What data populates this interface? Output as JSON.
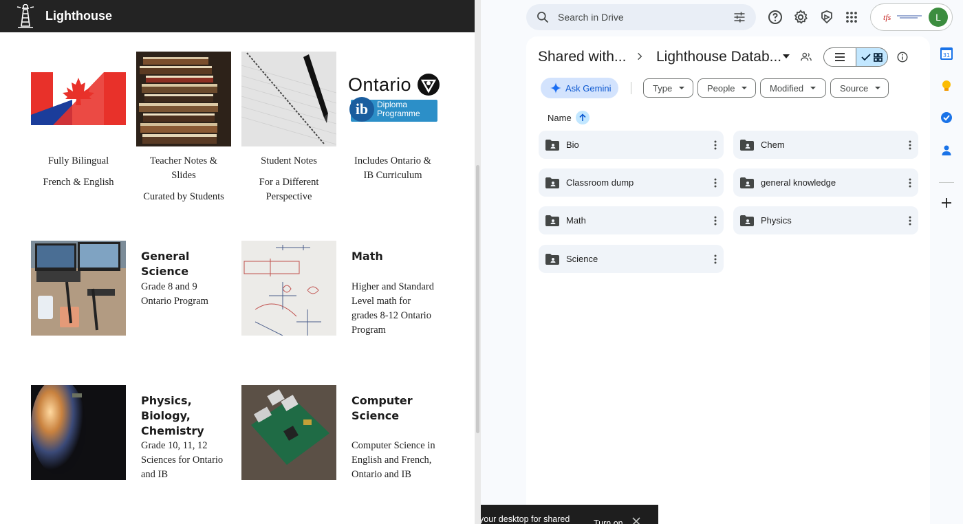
{
  "lighthouse": {
    "brand": "Lighthouse",
    "tiles": [
      {
        "lines": [
          "Fully Bilingual",
          "French & English"
        ]
      },
      {
        "lines": [
          "Teacher Notes & Slides",
          "Curated by Students"
        ]
      },
      {
        "lines": [
          "Student Notes",
          "For a Different Perspective"
        ]
      },
      {
        "lines": [
          "Includes Ontario & IB Curriculum"
        ]
      }
    ],
    "ontario_logo_text": "Ontario",
    "ib_logo_text": [
      "Diploma",
      "Programme"
    ],
    "subjects": [
      {
        "title": "General Science",
        "desc": "Grade 8 and 9 Ontario Program"
      },
      {
        "title": "Math",
        "desc": "Higher and Standard Level math for grades 8-12 Ontario Program"
      },
      {
        "title": "Physics, Biology, Chemistry",
        "desc": "Grade 10, 11, 12 Sciences for Ontario and IB"
      },
      {
        "title": "Computer Science",
        "desc": "Computer Science in English and French, Ontario and IB"
      }
    ]
  },
  "drive": {
    "search_placeholder": "Search in Drive",
    "avatar_letter": "L",
    "org_logo_text": "tfs",
    "breadcrumb": [
      "Shared with...",
      "Lighthouse Datab..."
    ],
    "ask_gemini": "Ask Gemini",
    "filters": [
      "Type",
      "People",
      "Modified",
      "Source"
    ],
    "sort_column": "Name",
    "folders": [
      "Bio",
      "Chem",
      "Classroom dump",
      "general knowledge",
      "Math",
      "Physics",
      "Science"
    ],
    "calendar_badge": "31"
  },
  "toast": {
    "message": "your desktop for shared",
    "button": "Turn on"
  }
}
